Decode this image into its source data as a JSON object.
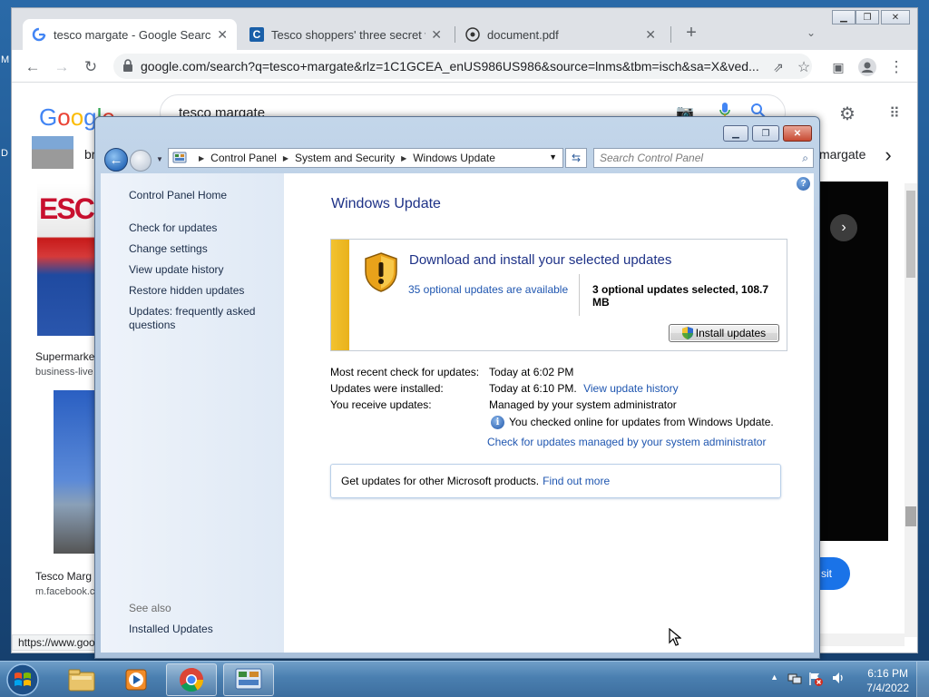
{
  "desktop": {
    "left_fragments": [
      "M",
      "D"
    ]
  },
  "chrome": {
    "tabs": [
      {
        "label": "tesco margate - Google Search",
        "icon": "google-g-icon"
      },
      {
        "label": "Tesco shoppers' three secret wor",
        "icon": "c-favicon-icon"
      },
      {
        "label": "document.pdf",
        "icon": "pdf-favicon-icon"
      }
    ],
    "url": "google.com/search?q=tesco+margate&rlz=1C1GCEA_enUS986US986&source=lnms&tbm=isch&sa=X&ved...",
    "status_url": "https://www.goo"
  },
  "google": {
    "logo": "Google",
    "query": "tesco margate",
    "chip_fragment": "br",
    "right_chip": "margate",
    "results": [
      {
        "title": "Supermarke",
        "source": "business-live"
      },
      {
        "title": "Tesco Marg",
        "source": "m.facebook.c"
      }
    ],
    "tesco_sign_text": "ESCO",
    "visit_fragment": "sit"
  },
  "control_panel": {
    "breadcrumb": [
      "Control Panel",
      "System and Security",
      "Windows Update"
    ],
    "search_placeholder": "Search Control Panel",
    "sidebar": {
      "home": "Control Panel Home",
      "links": [
        "Check for updates",
        "Change settings",
        "View update history",
        "Restore hidden updates",
        "Updates: frequently asked questions"
      ],
      "see_also_label": "See also",
      "see_also_links": [
        "Installed Updates"
      ]
    },
    "title": "Windows Update",
    "update_box": {
      "heading": "Download and install your selected updates",
      "optional_link": "35 optional updates are available",
      "selected_summary": "3 optional updates selected, 108.7 MB",
      "install_button": "Install updates"
    },
    "info": {
      "recent_check_label": "Most recent check for updates:",
      "recent_check_value": "Today at 6:02 PM",
      "installed_label": "Updates were installed:",
      "installed_value": "Today at 6:10 PM.",
      "history_link": "View update history",
      "receive_label": "You receive updates:",
      "receive_value": "Managed by your system administrator",
      "online_note": "You checked online for updates from Windows Update.",
      "admin_link": "Check for updates managed by your system administrator"
    },
    "ms_box": {
      "text": "Get updates for other Microsoft products.",
      "link": "Find out more"
    }
  },
  "taskbar": {
    "apps": [
      "file-explorer-icon",
      "media-player-icon",
      "chrome-icon",
      "control-panel-icon"
    ],
    "time": "6:16 PM",
    "date": "7/4/2022"
  }
}
